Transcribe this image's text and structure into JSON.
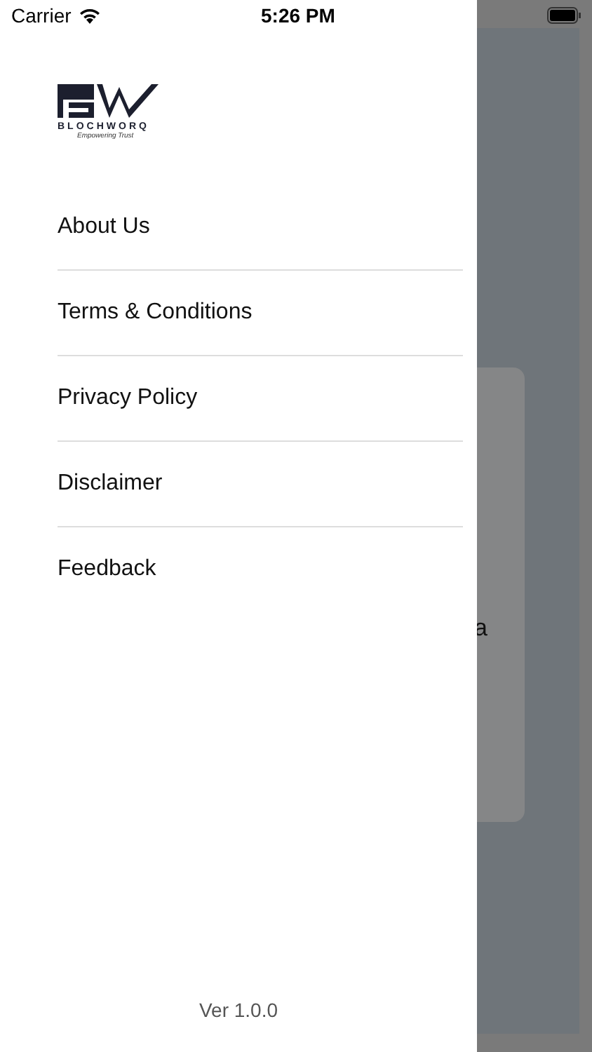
{
  "status_bar": {
    "carrier": "Carrier",
    "time": "5:26 PM"
  },
  "logo": {
    "name": "BLOCHWORQ",
    "tagline": "Empowering Trust"
  },
  "menu": [
    {
      "label": "About Us"
    },
    {
      "label": "Terms & Conditions"
    },
    {
      "label": "Privacy Policy"
    },
    {
      "label": "Disclaimer"
    },
    {
      "label": "Feedback"
    }
  ],
  "version": "Ver 1.0.0",
  "background": {
    "text_fragment": "a"
  }
}
